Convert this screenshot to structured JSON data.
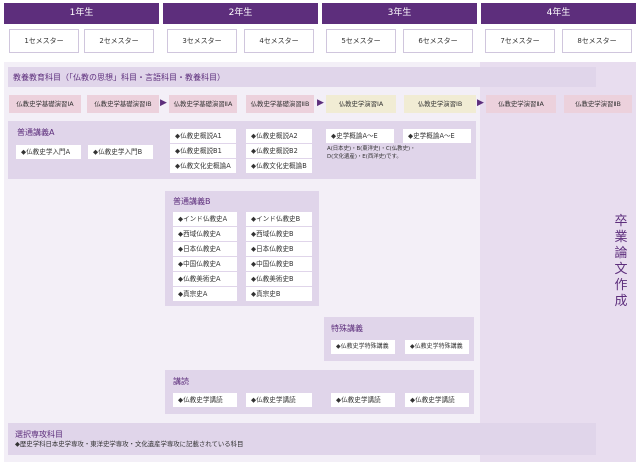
{
  "years": [
    "1年生",
    "2年生",
    "3年生",
    "4年生"
  ],
  "semesters": [
    "1セメスター",
    "2セメスター",
    "3セメスター",
    "4セメスター",
    "5セメスター",
    "6セメスター",
    "7セメスター",
    "8セメスター"
  ],
  "general_band": {
    "title": "教養教育科目（「仏教の思想」科目・言語科目・教養科目）"
  },
  "seminars": [
    "仏教史学基礎演習ⅠA",
    "仏教史学基礎演習ⅠB",
    "仏教史学基礎演習ⅡA",
    "仏教史学基礎演習ⅡB",
    "仏教史学演習ⅠA",
    "仏教史学演習ⅠB",
    "仏教史学演習ⅡA",
    "仏教史学演習ⅡB"
  ],
  "lecture_a": {
    "title": "普通講義A",
    "items": [
      "仏教史学入門A",
      "仏教史学入門B"
    ]
  },
  "lecture_a2": {
    "items": [
      "仏教史概説A1",
      "仏教史概説A2",
      "仏教史概説B1",
      "仏教史概説B2",
      "仏教文化史概論A",
      "仏教文化史概論B"
    ]
  },
  "history_overview": {
    "items": [
      "史学概論A～E",
      "史学概論A～E"
    ],
    "note_line1": "A(日本史)・B(東洋史)・C(仏教史)・",
    "note_line2": "D(文化遺産)・E(西洋史)です。"
  },
  "lecture_b": {
    "title": "普通講義B",
    "items": [
      "インド仏教史A",
      "インド仏教史B",
      "西域仏教史A",
      "西域仏教史B",
      "日本仏教史A",
      "日本仏教史B",
      "中国仏教史A",
      "中国仏教史B",
      "仏教美術史A",
      "仏教美術史B",
      "真宗史A",
      "真宗史B"
    ]
  },
  "special": {
    "title": "特殊講義",
    "items": [
      "仏教史学特殊講義",
      "仏教史学特殊講義"
    ]
  },
  "reading": {
    "title": "講読",
    "items": [
      "仏教史学講読",
      "仏教史学講読",
      "仏教史学講読",
      "仏教史学講読"
    ]
  },
  "elective": {
    "title": "選択専攻科目",
    "text": "歴史学科日本史学専攻・東洋史学専攻・文化遺産学専攻に記載されている科目"
  },
  "thesis": {
    "chars": [
      "卒",
      "業",
      "論",
      "文",
      "作",
      "成"
    ]
  },
  "colors": {
    "year_header": "#5d2e7c",
    "band": "#e0d5ea",
    "seminar_red": "#ecd1dc",
    "seminar_yellow": "#f1ecd4",
    "accent_text": "#5d2e7c"
  }
}
